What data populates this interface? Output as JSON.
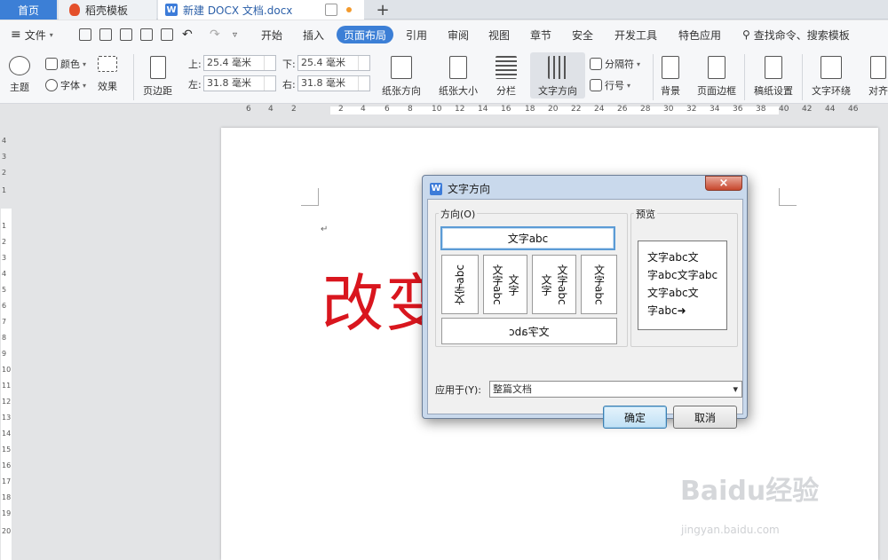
{
  "tabs": {
    "home": "首页",
    "docer": "稻壳模板",
    "doc": "新建 DOCX 文档.docx",
    "new_tab": "+"
  },
  "menu": {
    "file": "文件",
    "items": [
      "开始",
      "插入",
      "页面布局",
      "引用",
      "审阅",
      "视图",
      "章节",
      "安全",
      "开发工具",
      "特色应用"
    ],
    "active": "页面布局",
    "search": "查找命令、搜索模板"
  },
  "ribbon": {
    "theme": "主题",
    "color": "颜色",
    "font": "字体",
    "effect": "效果",
    "margins": "页边距",
    "top_label": "上:",
    "top_value": "25.4 毫米",
    "bottom_label": "下:",
    "bottom_value": "25.4 毫米",
    "left_label": "左:",
    "left_value": "31.8 毫米",
    "right_label": "右:",
    "right_value": "31.8 毫米",
    "orientation": "纸张方向",
    "size": "纸张大小",
    "columns": "分栏",
    "text_direction": "文字方向",
    "breaks": "分隔符",
    "line_numbers": "行号",
    "background": "背景",
    "page_border": "页面边框",
    "paper_setup": "稿纸设置",
    "wrap": "文字环绕",
    "align": "对齐"
  },
  "ruler": {
    "h_ticks": [
      "6",
      "4",
      "2",
      "2",
      "4",
      "6",
      "8",
      "10",
      "12",
      "14",
      "16",
      "18",
      "20",
      "22",
      "24",
      "26",
      "28",
      "30",
      "32",
      "34",
      "36",
      "38",
      "40",
      "42",
      "44",
      "46"
    ],
    "v_ticks": [
      "4",
      "3",
      "2",
      "1",
      "1",
      "2",
      "3",
      "4",
      "5",
      "6",
      "7",
      "8",
      "9",
      "10",
      "11",
      "12",
      "13",
      "14",
      "15",
      "16",
      "17",
      "18",
      "19",
      "20"
    ]
  },
  "document": {
    "big_text": "改变",
    "para_mark": "↵"
  },
  "dialog": {
    "title": "文字方向",
    "close": "×",
    "direction_group": "方向(O)",
    "preview_group": "预览",
    "opt_horizontal": "文字abc",
    "opt_vertical_ccw": "文字abc",
    "opt_vertical_cols_a": "文字abc",
    "opt_vertical_cols_b": "文字",
    "opt_vertical_cols_c": "文字abc",
    "opt_vertical_cols_d": "文字",
    "opt_vertical_cw": "文字abc",
    "opt_horizontal_flip": "文字abc",
    "preview_text": [
      "文字abc文",
      "字abc文字abc",
      "文字abc文",
      "字abc➜"
    ],
    "apply_label": "应用于(Y):",
    "apply_value": "整篇文档",
    "ok": "确定",
    "cancel": "取消"
  },
  "watermark": {
    "brand": "Baidu经验",
    "url": "jingyan.baidu.com"
  }
}
